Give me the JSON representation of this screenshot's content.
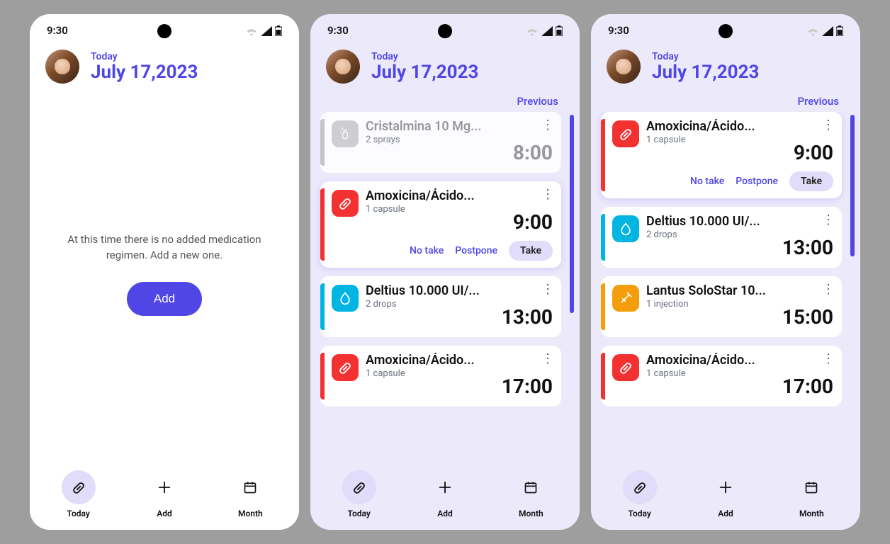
{
  "status": {
    "time": "9:30"
  },
  "header": {
    "label": "Today",
    "date": "July 17,2023"
  },
  "prev_label": "Previous",
  "empty": {
    "text": "At this time there is no added medication regimen. Add a new one.",
    "button": "Add"
  },
  "nav": {
    "today": "Today",
    "add": "Add",
    "month": "Month"
  },
  "screen2": {
    "cards": [
      {
        "title": "Cristalmina 10 Mg...",
        "dose": "2 sprays",
        "time": "8:00",
        "style": "inactive",
        "icon": "spray",
        "actions": false
      },
      {
        "title": "Amoxicina/Ácido...",
        "dose": "1 capsule",
        "time": "9:00",
        "style": "red",
        "icon": "pill",
        "actions": true
      },
      {
        "title": "Deltius 10.000 UI/...",
        "dose": "2 drops",
        "time": "13:00",
        "style": "cyan",
        "icon": "drop",
        "actions": false
      },
      {
        "title": "Amoxicina/Ácido...",
        "dose": "1 capsule",
        "time": "17:00",
        "style": "red",
        "icon": "pill",
        "actions": false
      }
    ]
  },
  "screen3": {
    "cards": [
      {
        "title": "Amoxicina/Ácido...",
        "dose": "1 capsule",
        "time": "9:00",
        "style": "red",
        "icon": "pill",
        "actions": true
      },
      {
        "title": "Deltius 10.000 UI/...",
        "dose": "2 drops",
        "time": "13:00",
        "style": "cyan",
        "icon": "drop",
        "actions": false
      },
      {
        "title": "Lantus SoloStar 10...",
        "dose": "1 injection",
        "time": "15:00",
        "style": "orange",
        "icon": "syringe",
        "actions": false
      },
      {
        "title": "Amoxicina/Ácido...",
        "dose": "1 capsule",
        "time": "17:00",
        "style": "red",
        "icon": "pill",
        "actions": false
      }
    ]
  },
  "actions": {
    "no_take": "No take",
    "postpone": "Postpone",
    "take": "Take"
  }
}
